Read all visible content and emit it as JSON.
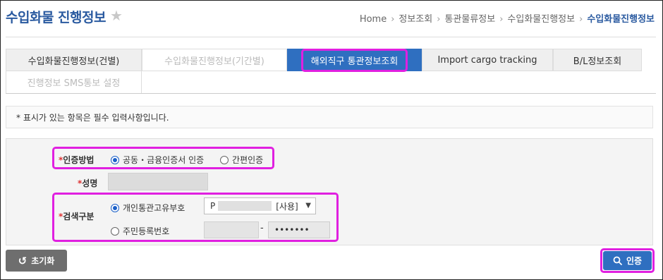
{
  "header": {
    "title": "수입화물 진행정보",
    "breadcrumb": [
      "Home",
      "정보조회",
      "통관물류정보",
      "수입화물진행정보",
      "수입화물진행정보"
    ]
  },
  "tabs": [
    {
      "label": "수입화물진행정보(건별)",
      "state": "normal"
    },
    {
      "label": "수입화물진행정보(기간별)",
      "state": "disabled"
    },
    {
      "label": "해외직구 통관정보조회",
      "state": "active"
    },
    {
      "label": "Import cargo tracking",
      "state": "normal"
    },
    {
      "label": "B/L정보조회",
      "state": "normal"
    },
    {
      "label": "진행정보 SMS통보 설정",
      "state": "disabled"
    }
  ],
  "notice": "* 표시가 있는 항목은 필수 입력사항입니다.",
  "form": {
    "auth_method": {
      "label": "인증방법",
      "options": [
        "공동・금융인증서 인증",
        "간편인증"
      ],
      "selected": "공동・금융인증서 인증"
    },
    "name": {
      "label": "성명"
    },
    "search_type": {
      "label": "검색구분",
      "options": [
        "개인통관고유부호",
        "주민등록번호"
      ],
      "selected": "개인통관고유부호",
      "customs_code_prefix": "P",
      "customs_code_suffix": "[사용]",
      "rrn_dash": "-",
      "rrn_back_masked": "•••••••"
    }
  },
  "buttons": {
    "reset": "초기화",
    "auth": "인증"
  },
  "colors": {
    "accent": "#2f6fc0",
    "title": "#2a5aa0",
    "highlight": "#e020e0",
    "required": "#dd3333"
  }
}
